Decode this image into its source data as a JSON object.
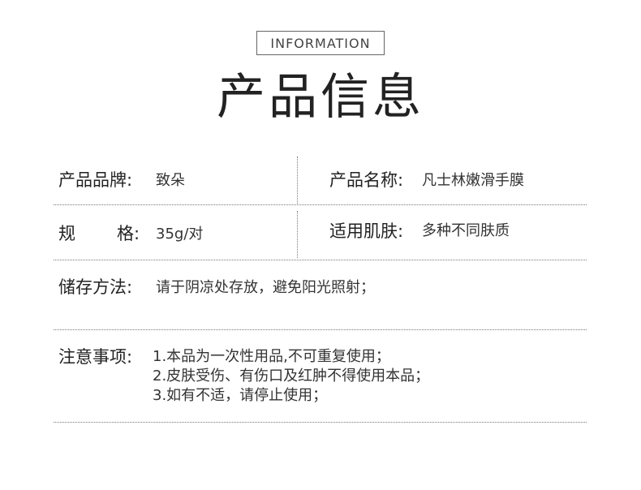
{
  "header": {
    "badge": "INFORMATION",
    "title": "产品信息"
  },
  "rows": {
    "brand": {
      "label": "产品品牌:",
      "value": "致朵"
    },
    "name": {
      "label": "产品名称:",
      "value": "凡士林嫩滑手膜"
    },
    "spec": {
      "label_a": "规",
      "label_b": "格:",
      "value": "35g/对"
    },
    "skin": {
      "label": "适用肌肤:",
      "value": "多种不同肤质"
    },
    "storage": {
      "label": "储存方法:",
      "value": "请于阴凉处存放，避免阳光照射；"
    },
    "notes": {
      "label": "注意事项:",
      "lines": [
        "1.本品为一次性用品,不可重复使用；",
        "2.皮肤受伤、有伤口及红肿不得使用本品；",
        "3.如有不适，请停止使用；"
      ]
    }
  }
}
